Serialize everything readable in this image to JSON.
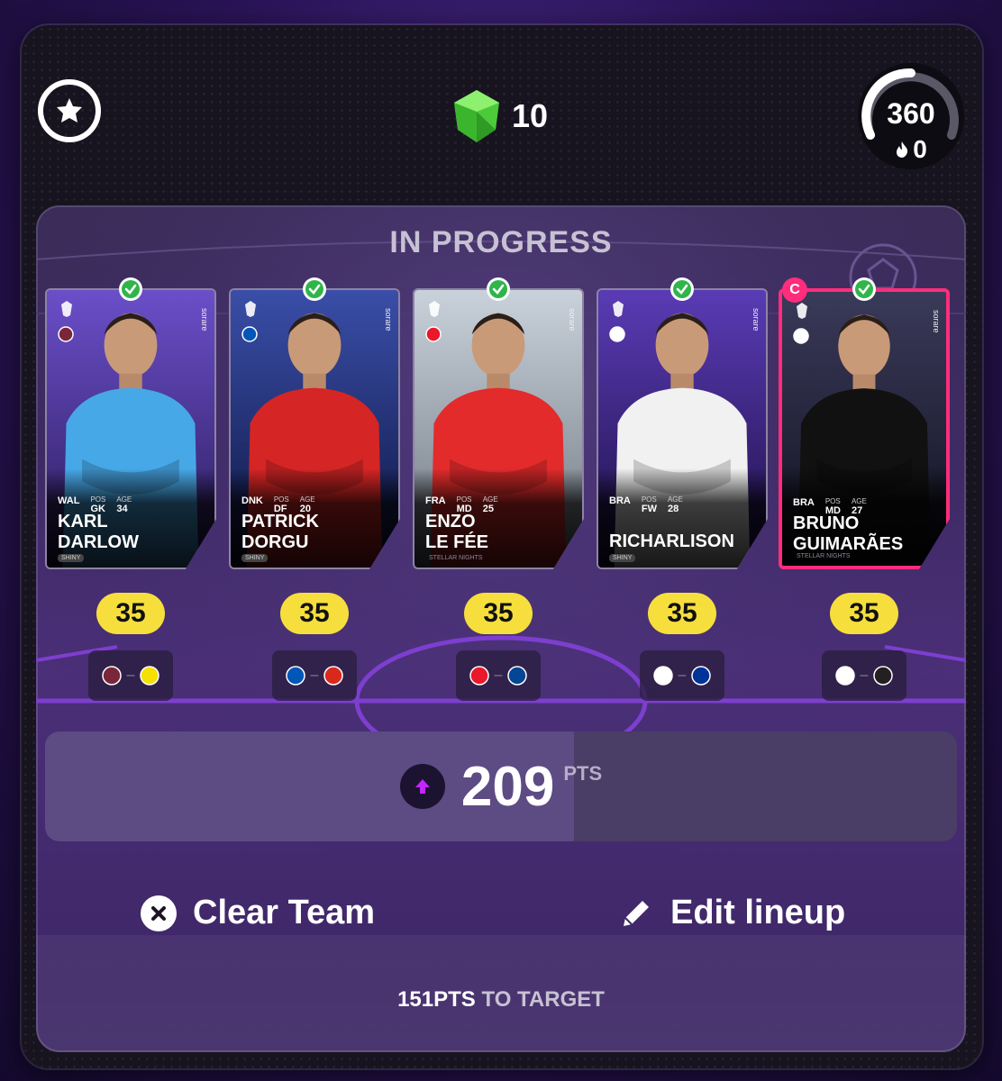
{
  "header": {
    "gem_count": "10",
    "gauge_value": "360",
    "fire_count": "0",
    "gem_color": "#4ccb3a"
  },
  "board": {
    "title": "IN PROGRESS",
    "players": [
      {
        "name1": "KARL",
        "name2": "DARLOW",
        "nat": "WAL",
        "pos_label": "POS",
        "pos": "GK",
        "age_label": "AGE",
        "age": "34",
        "tag": "SHINY",
        "score": "35",
        "home_color": "#7a263a",
        "away_color": "#f6e000",
        "photo_top": "#6a4fc9",
        "photo_bottom": "#2b1b5a",
        "kit": "#47a8e8"
      },
      {
        "name1": "PATRICK",
        "name2": "DORGU",
        "nat": "DNK",
        "pos_label": "POS",
        "pos": "DF",
        "age_label": "AGE",
        "age": "20",
        "tag": "SHINY",
        "score": "35",
        "home_color": "#0057b8",
        "away_color": "#da291c",
        "photo_top": "#3a4ea8",
        "photo_bottom": "#0d1540",
        "kit": "#d62525"
      },
      {
        "name1": "ENZO",
        "name2": "LE FÉE",
        "nat": "FRA",
        "pos_label": "POS",
        "pos": "MD",
        "age_label": "AGE",
        "age": "25",
        "tag": "STELLAR NIGHTS",
        "score": "35",
        "home_color": "#eb172b",
        "away_color": "#034694",
        "photo_top": "#c9d2db",
        "photo_bottom": "#6e7580",
        "kit": "#e32b2b"
      },
      {
        "name1": "RICHARLISON",
        "name2": "",
        "nat": "BRA",
        "pos_label": "POS",
        "pos": "FW",
        "age_label": "AGE",
        "age": "28",
        "tag": "SHINY",
        "score": "35",
        "home_color": "#ffffff",
        "away_color": "#003399",
        "photo_top": "#5a3bb5",
        "photo_bottom": "#1c0f45",
        "kit": "#f1f1f1"
      },
      {
        "name1": "BRUNO",
        "name2": "GUIMARÃES",
        "nat": "BRA",
        "pos_label": "POS",
        "pos": "MD",
        "age_label": "AGE",
        "age": "27",
        "tag": "STELLAR NIGHTS",
        "score": "35",
        "home_color": "#ffffff",
        "away_color": "#241f20",
        "photo_top": "#3a3a5a",
        "photo_bottom": "#10101e",
        "kit": "#111111"
      }
    ],
    "brand": "sorare",
    "captain_letter": "C"
  },
  "total": {
    "value": "209",
    "unit": "PTS",
    "progress": 0.58
  },
  "actions": {
    "clear": "Clear Team",
    "edit": "Edit lineup"
  },
  "target": {
    "value": "151PTS",
    "suffix": " TO TARGET"
  }
}
